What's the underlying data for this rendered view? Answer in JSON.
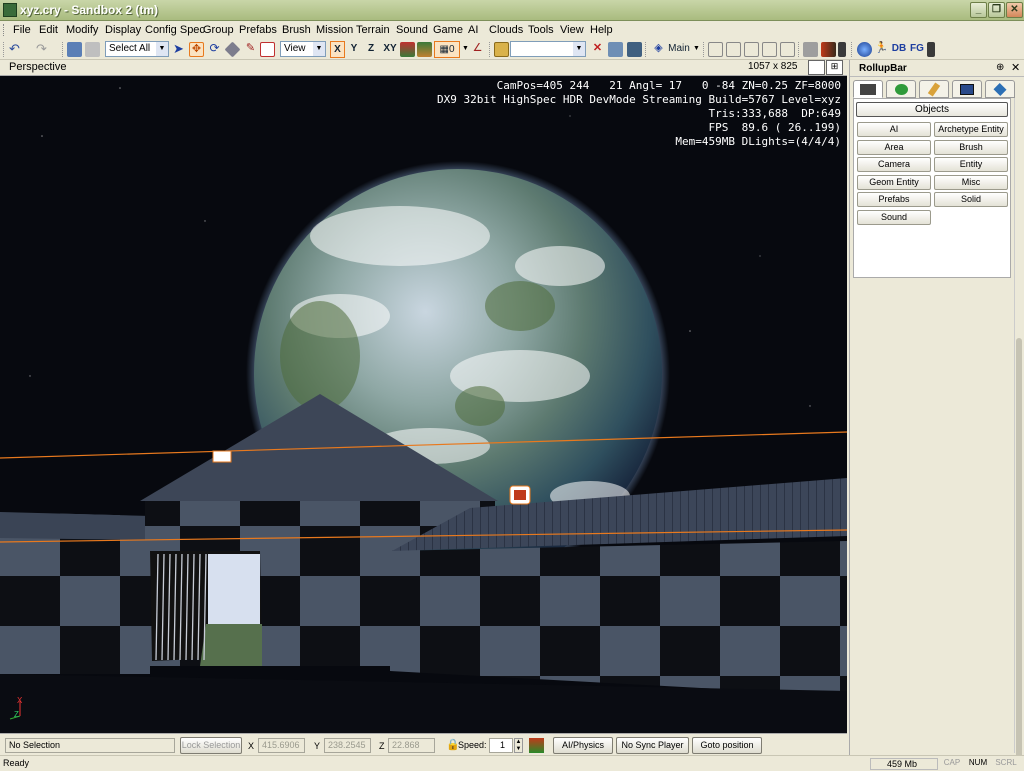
{
  "window": {
    "title": "xyz.cry - Sandbox 2 (tm)"
  },
  "menu": [
    "File",
    "Edit",
    "Modify",
    "Display",
    "Config Spec",
    "Group",
    "Prefabs",
    "Brush",
    "Mission",
    "Terrain",
    "Sound",
    "Game",
    "AI",
    "Clouds",
    "Tools",
    "View",
    "Help"
  ],
  "toolbar": {
    "selection_combo": "Select All",
    "view_combo": "View",
    "axis_buttons": [
      "X",
      "Y",
      "Z",
      "XY"
    ],
    "snap_value": "0",
    "layer_label": "Main",
    "db_label": "DB",
    "fg_label": "FG"
  },
  "viewport": {
    "name": "Perspective",
    "resolution": "1057 x 825",
    "hud_lines": [
      "CamPos=405 244   21 Angl= 17   0 -84 ZN=0.25 ZF=8000",
      "DX9 32bit HighSpec HDR DevMode Streaming Build=5767 Level=xyz",
      "Tris:333,688  DP:649",
      "FPS  89.6 ( 26..199)",
      "Mem=459MB DLights=(4/4/4)"
    ],
    "gizmo_x": "X",
    "gizmo_z": "Z"
  },
  "rollup": {
    "title": "RollupBar",
    "objects_label": "Objects",
    "buttons": [
      "AI",
      "Archetype Entity",
      "Area",
      "Brush",
      "Camera",
      "Entity",
      "Geom Entity",
      "Misc",
      "Prefabs",
      "Solid",
      "Sound"
    ]
  },
  "status": {
    "selection": "No Selection",
    "lock_selection": "Lock Selection",
    "x_label": "X",
    "x_value": "415.6906",
    "y_label": "Y",
    "y_value": "238.2545",
    "z_label": "Z",
    "z_value": "22.868",
    "speed_label": "Speed:",
    "speed_value": "1",
    "ai_physics": "AI/Physics",
    "no_sync": "No Sync Player",
    "goto": "Goto position",
    "ready": "Ready",
    "memory": "459 Mb",
    "cap": "CAP",
    "num": "NUM",
    "scrl": "SCRL"
  },
  "colors": {
    "accent": "#e8791e",
    "title_green": "#a9bb7f"
  }
}
